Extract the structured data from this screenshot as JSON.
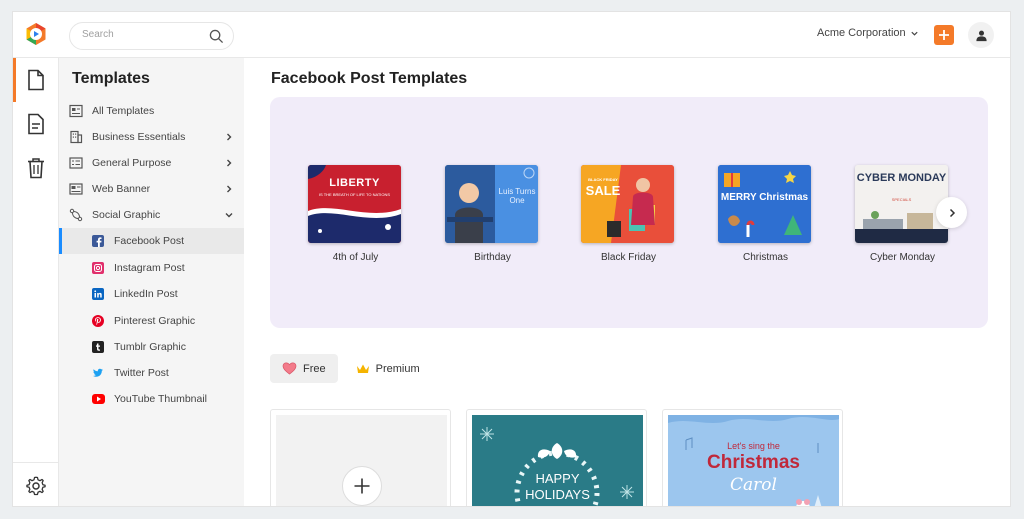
{
  "topbar": {
    "search_placeholder": "Search",
    "org_name": "Acme Corporation",
    "accent": "#f47a29"
  },
  "rail": {
    "items": [
      {
        "icon": "document-icon",
        "active": true
      },
      {
        "icon": "file-text-icon",
        "active": false
      },
      {
        "icon": "trash-icon",
        "active": false
      }
    ],
    "settings_icon": "gear-icon"
  },
  "sidebar": {
    "title": "Templates",
    "items": [
      {
        "label": "All Templates",
        "icon": "grid-icon",
        "chevron": ""
      },
      {
        "label": "Business Essentials",
        "icon": "building-icon",
        "chevron": "right"
      },
      {
        "label": "General Purpose",
        "icon": "list-icon",
        "chevron": "right"
      },
      {
        "label": "Web Banner",
        "icon": "banner-icon",
        "chevron": "right"
      },
      {
        "label": "Social Graphic",
        "icon": "share-icon",
        "chevron": "down"
      }
    ],
    "sub_items": [
      {
        "label": "Facebook Post",
        "icon": "facebook-icon",
        "color": "#3b5998",
        "active": true
      },
      {
        "label": "Instagram Post",
        "icon": "instagram-icon",
        "color": "#e1306c",
        "active": false
      },
      {
        "label": "LinkedIn Post",
        "icon": "linkedin-icon",
        "color": "#0a66c2",
        "active": false
      },
      {
        "label": "Pinterest Graphic",
        "icon": "pinterest-icon",
        "color": "#e60023",
        "active": false
      },
      {
        "label": "Tumblr Graphic",
        "icon": "tumblr-icon",
        "color": "#222222",
        "active": false
      },
      {
        "label": "Twitter Post",
        "icon": "twitter-icon",
        "color": "#1da1f2",
        "active": false
      },
      {
        "label": "YouTube Thumbnail",
        "icon": "youtube-icon",
        "color": "#ff0000",
        "active": false
      }
    ]
  },
  "main": {
    "title": "Facebook Post Templates",
    "carousel": [
      {
        "caption": "4th of July",
        "headline": "LIBERTY",
        "sub": "IS THE BREATH OF LIFE TO NATIONS"
      },
      {
        "caption": "Birthday",
        "headline": "Luis Turns One",
        "sub": ""
      },
      {
        "caption": "Black Friday",
        "headline": "SALE",
        "sub": "BLACK FRIDAY"
      },
      {
        "caption": "Christmas",
        "headline": "MERRY Christmas",
        "sub": ""
      },
      {
        "caption": "Cyber Monday",
        "headline": "CYBER MONDAY",
        "sub": "SPECIALS"
      }
    ],
    "filters": [
      {
        "label": "Free",
        "icon": "heart-icon",
        "active": true
      },
      {
        "label": "Premium",
        "icon": "crown-icon",
        "active": false
      }
    ],
    "tiles": [
      {
        "type": "add",
        "icon": "plus-icon"
      },
      {
        "type": "template",
        "headline_1": "HAPPY",
        "headline_2": "HOLIDAYS"
      },
      {
        "type": "template",
        "line_1": "Let's sing the",
        "line_2": "Christmas",
        "line_3": "Carol"
      }
    ]
  }
}
